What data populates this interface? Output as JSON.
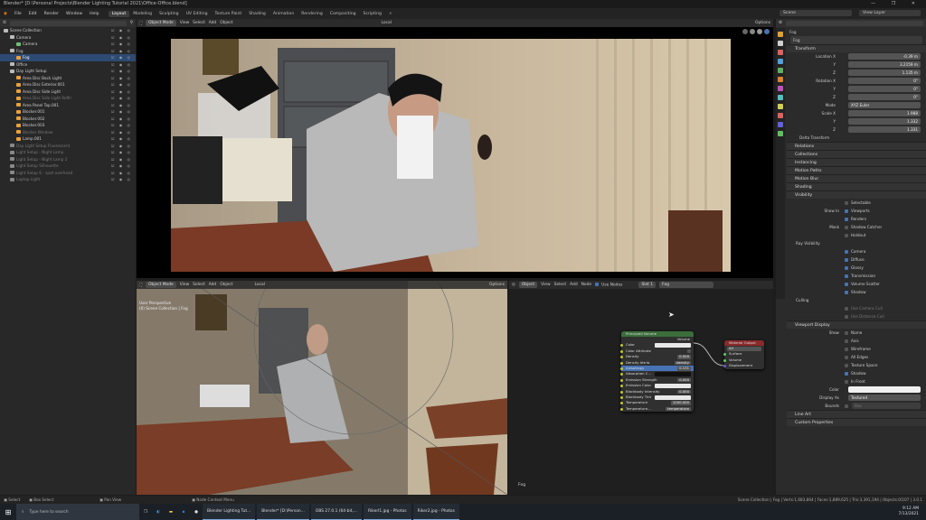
{
  "app": {
    "title": "Blender* [D:\\Personal Projects\\Blender Lighting Tutorial 2021\\Office-Office.blend]",
    "window_controls": "— ❐ ✕"
  },
  "menu": {
    "items": [
      "File",
      "Edit",
      "Render",
      "Window",
      "Help"
    ],
    "workspaces": [
      "Layout",
      "Modeling",
      "Sculpting",
      "UV Editing",
      "Texture Paint",
      "Shading",
      "Animation",
      "Rendering",
      "Compositing",
      "Scripting",
      "+"
    ],
    "scene": "Scene",
    "view_layer": "View Layer"
  },
  "outliner": {
    "rows": [
      {
        "label": "Scene Collection",
        "indent": 0,
        "dim": false,
        "sel": false,
        "color": "#bbbbbb"
      },
      {
        "label": "Camera",
        "indent": 1,
        "dim": false,
        "sel": false,
        "color": "#bbbbbb"
      },
      {
        "label": "Camera",
        "indent": 2,
        "dim": false,
        "sel": false,
        "color": "#6fbf73"
      },
      {
        "label": "Fog",
        "indent": 1,
        "dim": false,
        "sel": false,
        "color": "#bbbbbb"
      },
      {
        "label": "Fog",
        "indent": 2,
        "dim": false,
        "sel": true,
        "color": "#e8a03c"
      },
      {
        "label": "Office",
        "indent": 1,
        "dim": false,
        "sel": false,
        "color": "#bbbbbb"
      },
      {
        "label": "Day Light Setup",
        "indent": 1,
        "dim": false,
        "sel": false,
        "color": "#bbbbbb"
      },
      {
        "label": "Area Disc Back Light",
        "indent": 2,
        "dim": false,
        "sel": false,
        "color": "#e8a03c"
      },
      {
        "label": "Area Disc Exterior.001",
        "indent": 2,
        "dim": false,
        "sel": false,
        "color": "#e8a03c"
      },
      {
        "label": "Area Disc Side Light",
        "indent": 2,
        "dim": false,
        "sel": false,
        "color": "#e8a03c"
      },
      {
        "label": "Area Disc Side Light Refill",
        "indent": 2,
        "dim": true,
        "sel": false,
        "color": "#e8a03c"
      },
      {
        "label": "Area Panel Top.001",
        "indent": 2,
        "dim": false,
        "sel": false,
        "color": "#e8a03c"
      },
      {
        "label": "Blocker.001",
        "indent": 2,
        "dim": false,
        "sel": false,
        "color": "#e8a03c"
      },
      {
        "label": "Blocker.002",
        "indent": 2,
        "dim": false,
        "sel": false,
        "color": "#e8a03c"
      },
      {
        "label": "Blocker.003",
        "indent": 2,
        "dim": false,
        "sel": false,
        "color": "#e8a03c"
      },
      {
        "label": "Blocker Window",
        "indent": 2,
        "dim": true,
        "sel": false,
        "color": "#e8a03c"
      },
      {
        "label": "Lamp.001",
        "indent": 2,
        "dim": false,
        "sel": false,
        "color": "#e8a03c"
      },
      {
        "label": "Day Light Setup Fluorescent",
        "indent": 1,
        "dim": true,
        "sel": false,
        "color": "#888888"
      },
      {
        "label": "Light Setup - Night Lamp",
        "indent": 1,
        "dim": true,
        "sel": false,
        "color": "#888888"
      },
      {
        "label": "Light Setup - Night Lamp 2",
        "indent": 1,
        "dim": true,
        "sel": false,
        "color": "#888888"
      },
      {
        "label": "Light Setup Silhouette",
        "indent": 1,
        "dim": true,
        "sel": false,
        "color": "#888888"
      },
      {
        "label": "Light Setup 6 - spot overhead",
        "indent": 1,
        "dim": true,
        "sel": false,
        "color": "#888888"
      },
      {
        "label": "Laptop Light",
        "indent": 1,
        "dim": true,
        "sel": false,
        "color": "#888888"
      }
    ]
  },
  "viewport_top": {
    "mode": "Object Mode",
    "menus": [
      "View",
      "Select",
      "Add",
      "Object"
    ],
    "orientation": "Local",
    "options": "Options"
  },
  "viewport_bot": {
    "mode": "Object Mode",
    "menus": [
      "View",
      "Select",
      "Add",
      "Object"
    ],
    "orientation": "Local",
    "options": "Options",
    "overlay_line1": "User Perspective",
    "overlay_line2": "(0) Scene Collection | Fog"
  },
  "node_editor": {
    "type": "Object",
    "menus": [
      "View",
      "Select",
      "Add",
      "Node"
    ],
    "use_nodes": "Use Nodes",
    "slot": "Slot 1",
    "material": "Fog",
    "footer": "Fog",
    "volume_node": {
      "title": "Principled Volume",
      "output": "Volume",
      "rows": [
        {
          "label": "Color",
          "value": ""
        },
        {
          "label": "Color Attribute",
          "value": ""
        },
        {
          "label": "Density",
          "value": "0.500"
        },
        {
          "label": "Density Attrib.",
          "value": "density"
        },
        {
          "label": "Anisotropy",
          "value": "0.131"
        },
        {
          "label": "Absorption C...",
          "value": ""
        },
        {
          "label": "Emission Strength",
          "value": "0.000"
        },
        {
          "label": "Emission Color",
          "value": ""
        },
        {
          "label": "Blackbody Intensity",
          "value": "0.000"
        },
        {
          "label": "Blackbody Tint",
          "value": ""
        },
        {
          "label": "Temperature",
          "value": "1000.000"
        },
        {
          "label": "Temperature...",
          "value": "temperature"
        }
      ]
    },
    "output_node": {
      "title": "Material Output",
      "target": "All",
      "rows": [
        "Surface",
        "Volume",
        "Displacement"
      ]
    }
  },
  "properties": {
    "object": "Fog",
    "header_tab": "Fog",
    "transform": {
      "title": "Transform",
      "location": {
        "label": "Location X",
        "x": "-0.39 m",
        "y": "3.2159 m",
        "z": "1.135 m"
      },
      "rotation": {
        "label": "Rotation X",
        "x": "0°",
        "y": "0°",
        "z": "0°"
      },
      "mode_label": "Mode",
      "mode": "XYZ Euler",
      "scale": {
        "label": "Scale X",
        "x": "1.988",
        "y": "1.332",
        "z": "1.331"
      },
      "delta": "Delta Transform"
    },
    "sections": [
      "Relations",
      "Collections",
      "Instancing",
      "Motion Paths",
      "Motion Blur",
      "Shading",
      "Visibility"
    ],
    "visibility": {
      "selectable": "Selectable",
      "show_in": "Show In",
      "viewports": "Viewports",
      "renders": "Renders",
      "mask": "Mask",
      "shadow_catcher": "Shadow Catcher",
      "holdout": "Holdout",
      "ray_visibility": "Ray Visibility",
      "rays": [
        "Camera",
        "Diffuse",
        "Glossy",
        "Transmission",
        "Volume Scatter",
        "Shadow"
      ],
      "culling": "Culling",
      "use_camera_cull": "Use Camera Cull",
      "use_distance_cull": "Use Distance Cull"
    },
    "viewport_display": {
      "title": "Viewport Display",
      "show_label": "Show",
      "show": [
        "Name",
        "Axis",
        "Wireframe",
        "All Edges",
        "Texture Space",
        "Shadow",
        "In Front"
      ],
      "color_label": "Color",
      "display_as_label": "Display As",
      "display_as": "Textured",
      "bounds_label": "Bounds",
      "bounds": "Box"
    },
    "more": [
      "Line Art",
      "Custom Properties"
    ]
  },
  "status": {
    "select": "Select",
    "box_select": "Box Select",
    "pan_view": "Pan View",
    "context_menu": "Node Context Menu",
    "info": "Scene Collection | Fog | Verts:1,683,864 | Faces:1,889,625 | Tris:3,391,194 | Objects:0/107 | 3.0.1"
  },
  "taskbar": {
    "search": "Type here to search",
    "apps": [
      "Blender Lighting Tut...",
      "Blender* [D:\\Person...",
      "OBS 27.0.1 (64-bit,...",
      "Rikerl1.jpg - Photos",
      "Riker2.jpg - Photos"
    ],
    "time": "9:12 AM",
    "date": "7/13/2021"
  }
}
